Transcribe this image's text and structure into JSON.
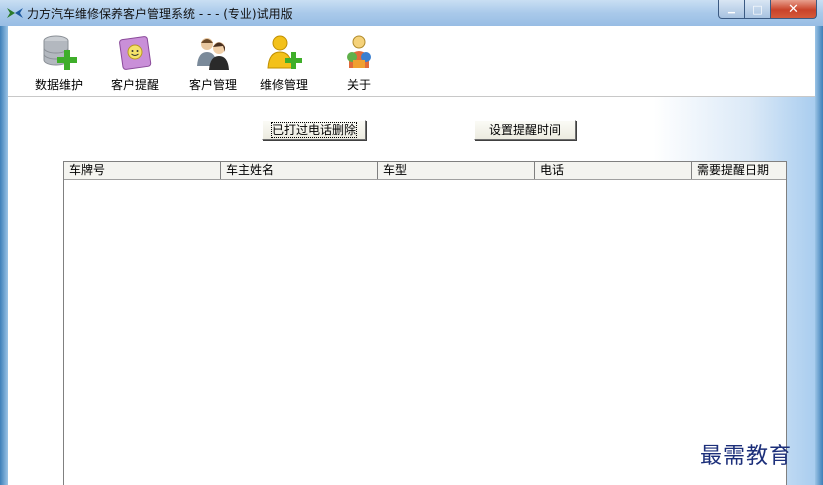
{
  "window": {
    "title": "力方汽车维修保养客户管理系统 - - - (专业)试用版",
    "minimize_glyph": "▁",
    "maximize_glyph": "□",
    "close_glyph": "✕"
  },
  "toolbar": {
    "items": [
      {
        "label": "数据维护",
        "icon": "database-add-icon"
      },
      {
        "label": "客户提醒",
        "icon": "notebook-icon"
      },
      {
        "label": "客户管理",
        "icon": "users-icon"
      },
      {
        "label": "维修管理",
        "icon": "user-add-icon"
      },
      {
        "label": "关于",
        "icon": "about-icon"
      }
    ]
  },
  "actions": {
    "delete_called": "已打过电话删除",
    "set_reminder_time": "设置提醒时间"
  },
  "table": {
    "columns": [
      "车牌号",
      "车主姓名",
      "车型",
      "电话",
      "需要提醒日期"
    ],
    "rows": []
  },
  "watermark": "最需教育"
}
